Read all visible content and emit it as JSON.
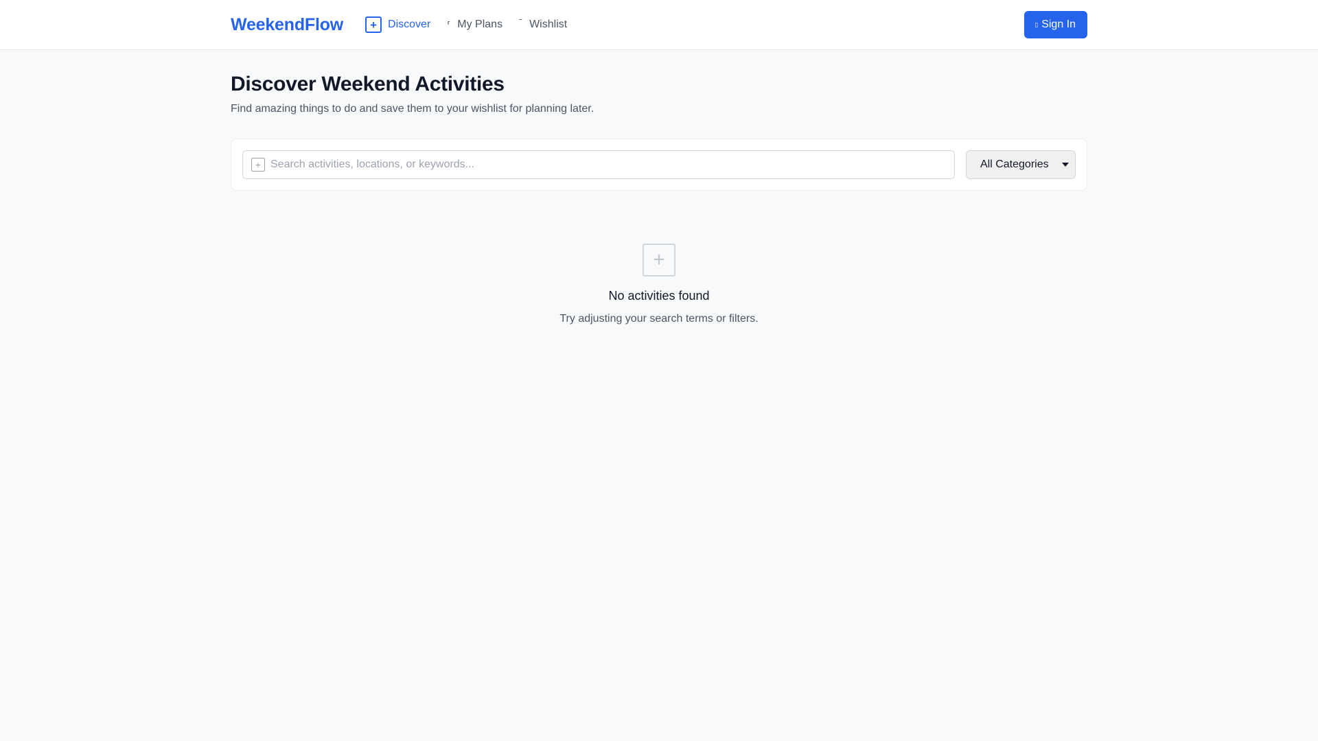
{
  "header": {
    "brand": "WeekendFlow",
    "nav": [
      {
        "label": "Discover",
        "icon": "plus-square-icon",
        "active": true
      },
      {
        "label": "My Plans",
        "icon": "calendar-icon",
        "active": false
      },
      {
        "label": "Wishlist",
        "icon": "heart-icon",
        "active": false
      }
    ],
    "sign_in_label": "Sign In",
    "sign_in_icon": "user-icon"
  },
  "main": {
    "title": "Discover Weekend Activities",
    "subtitle": "Find amazing things to do and save them to your wishlist for planning later.",
    "search": {
      "placeholder": "Search activities, locations, or keywords...",
      "value": "",
      "icon": "search-icon"
    },
    "category_filter": {
      "selected": "All Categories"
    },
    "empty_state": {
      "icon": "plus-square-icon",
      "title": "No activities found",
      "message": "Try adjusting your search terms or filters."
    }
  },
  "colors": {
    "accent": "#2563eb",
    "background": "#f8f9fb",
    "text": "#111827",
    "muted_text": "#4b5563"
  }
}
